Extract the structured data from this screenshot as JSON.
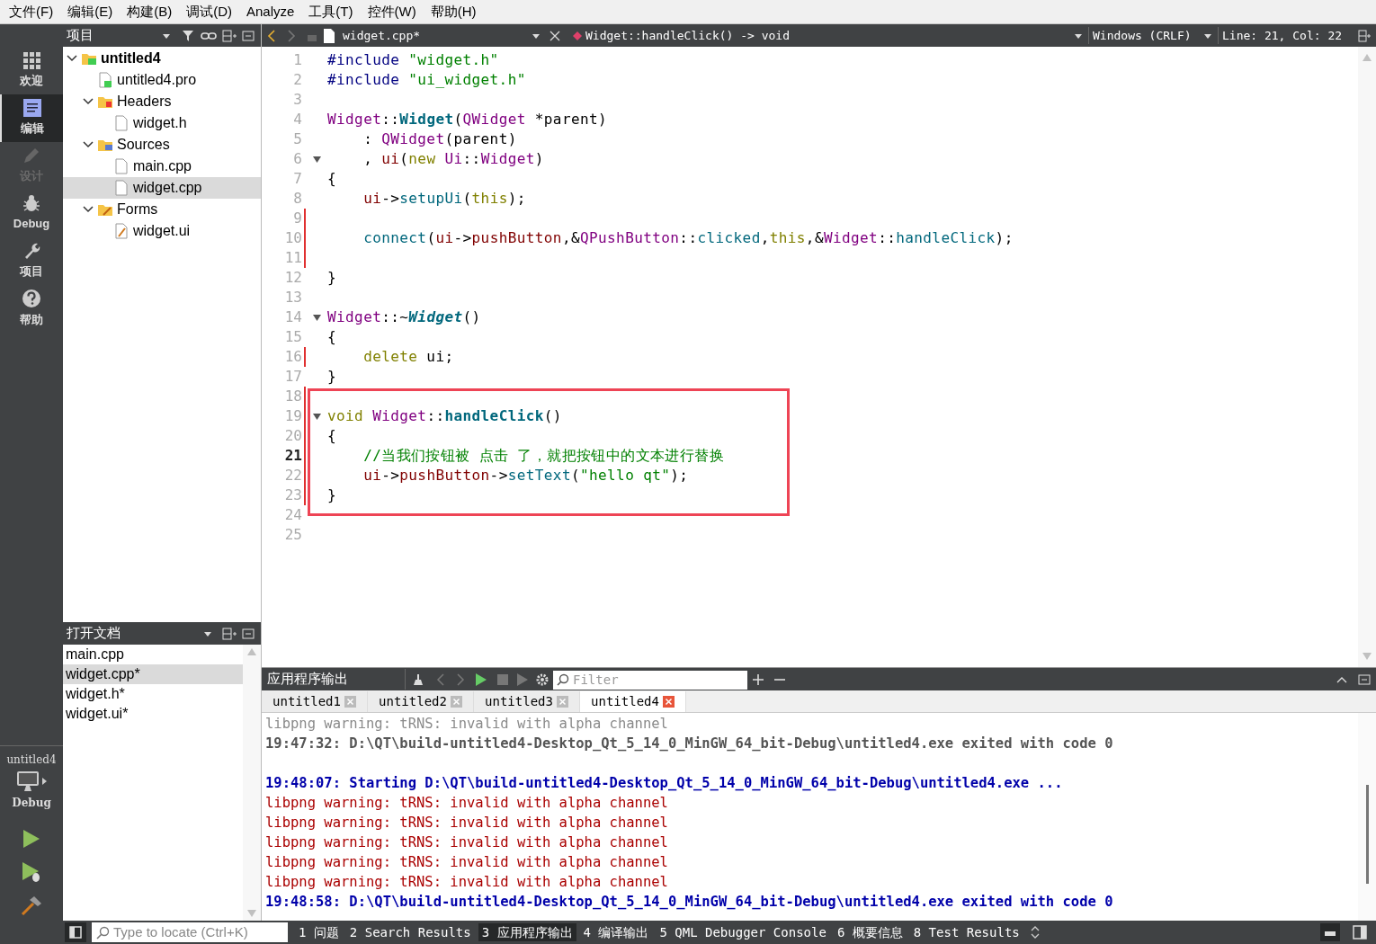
{
  "menu": [
    "文件(F)",
    "编辑(E)",
    "构建(B)",
    "调试(D)",
    "Analyze",
    "工具(T)",
    "控件(W)",
    "帮助(H)"
  ],
  "modes": [
    {
      "label": "欢迎",
      "selected": false,
      "disabled": false
    },
    {
      "label": "编辑",
      "selected": true,
      "disabled": false
    },
    {
      "label": "设计",
      "selected": false,
      "disabled": true
    },
    {
      "label": "Debug",
      "selected": false,
      "disabled": false
    },
    {
      "label": "项目",
      "selected": false,
      "disabled": false
    },
    {
      "label": "帮助",
      "selected": false,
      "disabled": false
    }
  ],
  "kit": {
    "project": "untitled4",
    "build": "Debug"
  },
  "project_pane": {
    "title": "项目",
    "tree": [
      {
        "label": "untitled4",
        "kind": "project",
        "expanded": true,
        "selected": false,
        "children": [
          {
            "label": "untitled4.pro",
            "kind": "pro",
            "selected": false
          },
          {
            "label": "Headers",
            "kind": "headers",
            "expanded": true,
            "selected": false,
            "children": [
              {
                "label": "widget.h",
                "kind": "file",
                "selected": false
              }
            ]
          },
          {
            "label": "Sources",
            "kind": "sources",
            "expanded": true,
            "selected": false,
            "children": [
              {
                "label": "main.cpp",
                "kind": "file",
                "selected": false
              },
              {
                "label": "widget.cpp",
                "kind": "file",
                "selected": true
              }
            ]
          },
          {
            "label": "Forms",
            "kind": "forms",
            "expanded": true,
            "selected": false,
            "children": [
              {
                "label": "widget.ui",
                "kind": "form",
                "selected": false
              }
            ]
          }
        ]
      }
    ]
  },
  "open_documents": {
    "title": "打开文档",
    "items": [
      {
        "label": "main.cpp",
        "selected": false
      },
      {
        "label": "widget.cpp*",
        "selected": true
      },
      {
        "label": "widget.h*",
        "selected": false
      },
      {
        "label": "widget.ui*",
        "selected": false
      }
    ]
  },
  "editor": {
    "file": "widget.cpp*",
    "symbol": "Widget::handleClick() -> void",
    "line_ending": "Windows (CRLF)",
    "position": "Line: 21, Col: 22",
    "lines": [
      {
        "number": "1",
        "tokens": [
          {
            "kind": "pp",
            "text": "#include "
          },
          {
            "kind": "str",
            "text": "\"widget.h\""
          }
        ],
        "fold": false,
        "changed": false,
        "current": false,
        "boxed": false
      },
      {
        "number": "2",
        "tokens": [
          {
            "kind": "pp",
            "text": "#include "
          },
          {
            "kind": "str",
            "text": "\"ui_widget.h\""
          }
        ],
        "fold": false,
        "changed": false,
        "current": false,
        "boxed": false
      },
      {
        "number": "3",
        "fold": false,
        "changed": false,
        "current": false,
        "boxed": false
      },
      {
        "number": "4",
        "tokens": [
          {
            "kind": "type",
            "text": "Widget"
          },
          {
            "kind": "plain",
            "text": "::"
          },
          {
            "kind": "fndecl",
            "text": "Widget"
          },
          {
            "kind": "plain",
            "text": "("
          },
          {
            "kind": "type",
            "text": "QWidget"
          },
          {
            "kind": "plain",
            "text": " *parent)"
          }
        ],
        "fold": false,
        "changed": false,
        "current": false,
        "boxed": false
      },
      {
        "number": "5",
        "tokens": [
          {
            "kind": "plain",
            "text": "    : "
          },
          {
            "kind": "type",
            "text": "QWidget"
          },
          {
            "kind": "plain",
            "text": "(parent)"
          }
        ],
        "fold": false,
        "changed": false,
        "current": false,
        "boxed": false
      },
      {
        "number": "6",
        "tokens": [
          {
            "kind": "plain",
            "text": "    , "
          },
          {
            "kind": "field",
            "text": "ui"
          },
          {
            "kind": "plain",
            "text": "("
          },
          {
            "kind": "kw",
            "text": "new"
          },
          {
            "kind": "type",
            "text": " Ui"
          },
          {
            "kind": "plain",
            "text": "::"
          },
          {
            "kind": "type",
            "text": "Widget"
          },
          {
            "kind": "plain",
            "text": ")"
          }
        ],
        "fold": true,
        "changed": false,
        "current": false,
        "boxed": false
      },
      {
        "number": "7",
        "tokens": [
          {
            "kind": "plain",
            "text": "{"
          }
        ],
        "fold": false,
        "changed": false,
        "current": false,
        "boxed": false
      },
      {
        "number": "8",
        "tokens": [
          {
            "kind": "field",
            "text": "    ui"
          },
          {
            "kind": "plain",
            "text": "->"
          },
          {
            "kind": "fn",
            "text": "setupUi"
          },
          {
            "kind": "plain",
            "text": "("
          },
          {
            "kind": "kw",
            "text": "this"
          },
          {
            "kind": "plain",
            "text": ");"
          }
        ],
        "fold": false,
        "changed": false,
        "current": false,
        "boxed": false
      },
      {
        "number": "9",
        "fold": false,
        "changed": true,
        "current": false,
        "boxed": false
      },
      {
        "number": "10",
        "tokens": [
          {
            "kind": "fn",
            "text": "    connect"
          },
          {
            "kind": "plain",
            "text": "("
          },
          {
            "kind": "field",
            "text": "ui"
          },
          {
            "kind": "plain",
            "text": "->"
          },
          {
            "kind": "field",
            "text": "pushButton"
          },
          {
            "kind": "plain",
            "text": ",&"
          },
          {
            "kind": "type",
            "text": "QPushButton"
          },
          {
            "kind": "plain",
            "text": "::"
          },
          {
            "kind": "fn",
            "text": "clicked"
          },
          {
            "kind": "plain",
            "text": ","
          },
          {
            "kind": "kw",
            "text": "this"
          },
          {
            "kind": "plain",
            "text": ",&"
          },
          {
            "kind": "type",
            "text": "Widget"
          },
          {
            "kind": "plain",
            "text": "::"
          },
          {
            "kind": "fn",
            "text": "handleClick"
          },
          {
            "kind": "plain",
            "text": ");"
          }
        ],
        "fold": false,
        "changed": true,
        "current": false,
        "boxed": false
      },
      {
        "number": "11",
        "fold": false,
        "changed": true,
        "current": false,
        "boxed": false
      },
      {
        "number": "12",
        "tokens": [
          {
            "kind": "plain",
            "text": "}"
          }
        ],
        "fold": false,
        "changed": false,
        "current": false,
        "boxed": false
      },
      {
        "number": "13",
        "fold": false,
        "changed": false,
        "current": false,
        "boxed": false
      },
      {
        "number": "14",
        "tokens": [
          {
            "kind": "type",
            "text": "Widget"
          },
          {
            "kind": "plain",
            "text": "::~"
          },
          {
            "kind": "fndecl_italic",
            "text": "Widget"
          },
          {
            "kind": "plain",
            "text": "()"
          }
        ],
        "fold": true,
        "changed": false,
        "current": false,
        "boxed": false
      },
      {
        "number": "15",
        "tokens": [
          {
            "kind": "plain",
            "text": "{"
          }
        ],
        "fold": false,
        "changed": false,
        "current": false,
        "boxed": false
      },
      {
        "number": "16",
        "tokens": [
          {
            "kind": "kw",
            "text": "    delete"
          },
          {
            "kind": "plain",
            "text": " ui;"
          }
        ],
        "fold": false,
        "changed": true,
        "current": false,
        "boxed": false
      },
      {
        "number": "17",
        "tokens": [
          {
            "kind": "plain",
            "text": "}"
          }
        ],
        "fold": false,
        "changed": false,
        "current": false,
        "boxed": false
      },
      {
        "number": "18",
        "fold": false,
        "changed": true,
        "current": false,
        "boxed": true
      },
      {
        "number": "19",
        "tokens": [
          {
            "kind": "kw",
            "text": "void"
          },
          {
            "kind": "type",
            "text": " Widget"
          },
          {
            "kind": "plain",
            "text": "::"
          },
          {
            "kind": "fndecl",
            "text": "handleClick"
          },
          {
            "kind": "plain",
            "text": "()"
          }
        ],
        "fold": true,
        "changed": true,
        "current": false,
        "boxed": true
      },
      {
        "number": "20",
        "tokens": [
          {
            "kind": "plain",
            "text": "{"
          }
        ],
        "fold": false,
        "changed": true,
        "current": false,
        "boxed": true
      },
      {
        "number": "21",
        "tokens": [
          {
            "kind": "comment",
            "text": "    //当我们按钮被 点击 了，就把按钮中的文本进行替换"
          }
        ],
        "fold": false,
        "changed": true,
        "current": true,
        "boxed": true
      },
      {
        "number": "22",
        "tokens": [
          {
            "kind": "field",
            "text": "    ui"
          },
          {
            "kind": "plain",
            "text": "->"
          },
          {
            "kind": "field",
            "text": "pushButton"
          },
          {
            "kind": "plain",
            "text": "->"
          },
          {
            "kind": "fn",
            "text": "setText"
          },
          {
            "kind": "plain",
            "text": "("
          },
          {
            "kind": "str",
            "text": "\"hello qt\""
          },
          {
            "kind": "plain",
            "text": ");"
          }
        ],
        "fold": false,
        "changed": true,
        "current": false,
        "boxed": true
      },
      {
        "number": "23",
        "tokens": [
          {
            "kind": "plain",
            "text": "}"
          }
        ],
        "fold": false,
        "changed": true,
        "current": false,
        "boxed": true
      },
      {
        "number": "24",
        "fold": false,
        "changed": false,
        "current": false,
        "boxed": false
      },
      {
        "number": "25",
        "fold": false,
        "changed": false,
        "current": false,
        "boxed": false
      }
    ]
  },
  "output_pane": {
    "title": "应用程序输出",
    "filter_placeholder": "Filter",
    "tabs": [
      {
        "label": "untitled1",
        "selected": false
      },
      {
        "label": "untitled2",
        "selected": false
      },
      {
        "label": "untitled3",
        "selected": false
      },
      {
        "label": "untitled4",
        "selected": true
      }
    ],
    "lines": [
      {
        "kind": "old_stderr",
        "text": "libpng warning: tRNS: invalid with alpha channel",
        "new_run": false
      },
      {
        "kind": "old_info",
        "text": "19:47:32: D:\\QT\\build-untitled4-Desktop_Qt_5_14_0_MinGW_64_bit-Debug\\untitled4.exe exited with code 0",
        "new_run": false
      },
      {
        "kind": "info",
        "text": "19:48:07: Starting D:\\QT\\build-untitled4-Desktop_Qt_5_14_0_MinGW_64_bit-Debug\\untitled4.exe ...",
        "new_run": true
      },
      {
        "kind": "stderr",
        "text": "libpng warning: tRNS: invalid with alpha channel",
        "new_run": false
      },
      {
        "kind": "stderr",
        "text": "libpng warning: tRNS: invalid with alpha channel",
        "new_run": false
      },
      {
        "kind": "stderr",
        "text": "libpng warning: tRNS: invalid with alpha channel",
        "new_run": false
      },
      {
        "kind": "stderr",
        "text": "libpng warning: tRNS: invalid with alpha channel",
        "new_run": false
      },
      {
        "kind": "stderr",
        "text": "libpng warning: tRNS: invalid with alpha channel",
        "new_run": false
      },
      {
        "kind": "info",
        "text": "19:48:58: D:\\QT\\build-untitled4-Desktop_Qt_5_14_0_MinGW_64_bit-Debug\\untitled4.exe exited with code 0",
        "new_run": false
      }
    ]
  },
  "status_bar": {
    "locate_placeholder": "Type to locate (Ctrl+K)",
    "tabs": [
      {
        "label": "1 问题",
        "selected": false
      },
      {
        "label": "2 Search Results",
        "selected": false
      },
      {
        "label": "3 应用程序输出",
        "selected": true
      },
      {
        "label": "4 编译输出",
        "selected": false
      },
      {
        "label": "5 QML Debugger Console",
        "selected": false
      },
      {
        "label": "6 概要信息",
        "selected": false
      },
      {
        "label": "8 Test Results",
        "selected": false
      }
    ]
  }
}
